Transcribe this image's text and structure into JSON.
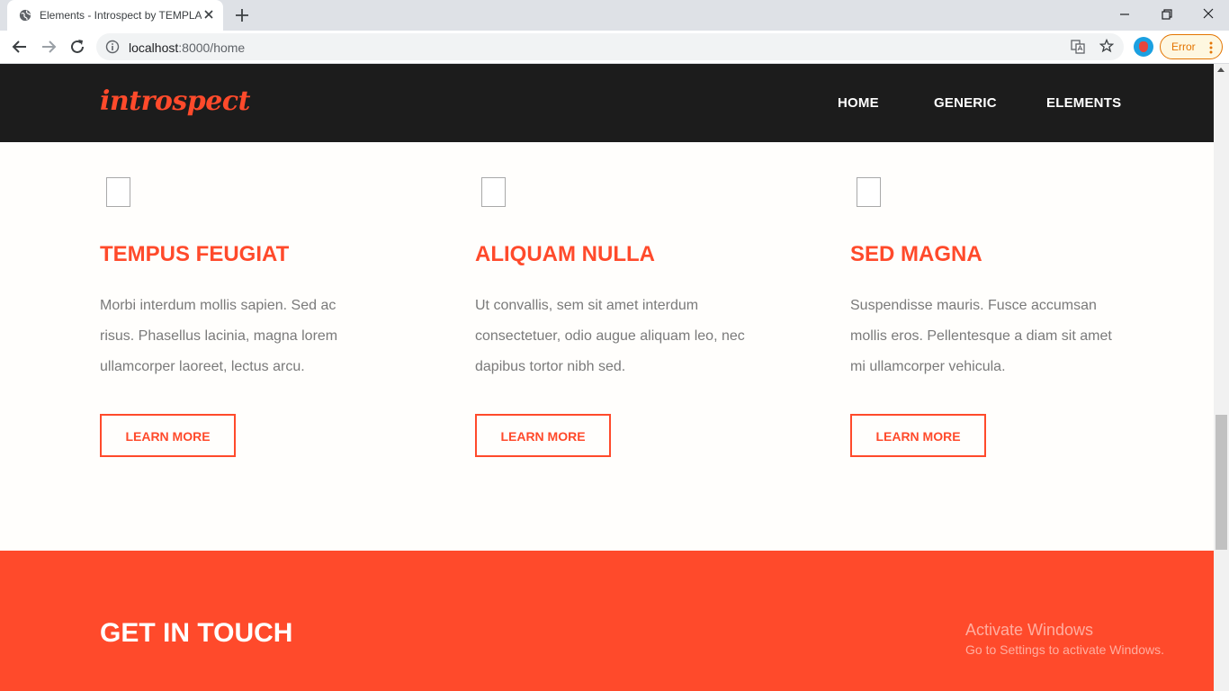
{
  "browser": {
    "tab_title": "Elements - Introspect by TEMPLA",
    "url_host": "localhost",
    "url_path": ":8000/home",
    "error_label": "Error",
    "icons": {
      "favicon": "globe-icon",
      "close": "close-icon",
      "new_tab": "plus-icon",
      "back": "back-arrow-icon",
      "forward": "forward-arrow-icon",
      "reload": "reload-icon",
      "info": "info-icon",
      "translate": "translate-icon",
      "bookmark": "star-icon",
      "menu": "more-vert-icon"
    }
  },
  "site": {
    "logo": "introspect",
    "nav": [
      "HOME",
      "GENERIC",
      "ELEMENTS"
    ],
    "features": [
      {
        "title": "TEMPUS FEUGIAT",
        "text": "Morbi interdum mollis sapien. Sed ac risus. Phasellus lacinia, magna lorem ullamcorper laoreet, lectus arcu.",
        "button": "LEARN MORE"
      },
      {
        "title": "ALIQUAM NULLA",
        "text": "Ut convallis, sem sit amet interdum consectetuer, odio augue aliquam leo, nec dapibus tortor nibh sed.",
        "button": "LEARN MORE"
      },
      {
        "title": "SED MAGNA",
        "text": "Suspendisse mauris. Fusce accumsan mollis eros. Pellentesque a diam sit amet mi ullamcorper vehicula.",
        "button": "LEARN MORE"
      }
    ],
    "contact_title": "GET IN TOUCH"
  },
  "watermark": {
    "line1": "Activate Windows",
    "line2": "Go to Settings to activate Windows."
  },
  "colors": {
    "accent": "#ff4a2b",
    "header_bg": "#1c1c1c",
    "body_text": "#7a7a7a"
  }
}
